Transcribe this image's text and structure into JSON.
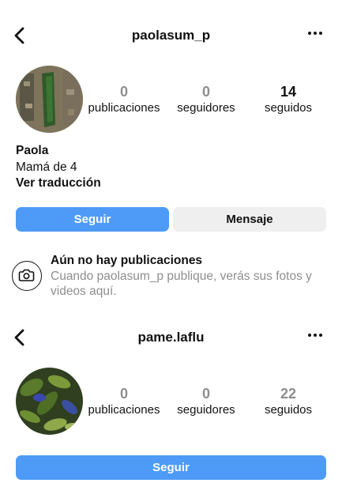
{
  "profiles": [
    {
      "username": "paolasum_p",
      "stats": [
        {
          "value": "0",
          "label": "publicaciones"
        },
        {
          "value": "0",
          "label": "seguidores"
        },
        {
          "value": "14",
          "label": "seguidos"
        }
      ],
      "bio": {
        "name": "Paola",
        "text": "Mamá de 4",
        "translate": "Ver traducción"
      },
      "buttons": {
        "follow": "Seguir",
        "message": "Mensaje"
      },
      "empty": {
        "title": "Aún no hay publicaciones",
        "subtitle": "Cuando paolasum_p publique, verás sus fotos y videos aquí."
      }
    },
    {
      "username": "pame.laflu",
      "stats": [
        {
          "value": "0",
          "label": "publicaciones"
        },
        {
          "value": "0",
          "label": "seguidores"
        },
        {
          "value": "22",
          "label": "seguidos"
        }
      ],
      "buttons": {
        "follow": "Seguir"
      }
    }
  ],
  "colors": {
    "accent": "#4d9bf7",
    "secondary_button": "#efefef",
    "muted_text": "#8e8e8e"
  },
  "icons": {
    "back": "chevron-left-icon",
    "more": "more-horizontal-icon",
    "camera": "camera-icon"
  }
}
